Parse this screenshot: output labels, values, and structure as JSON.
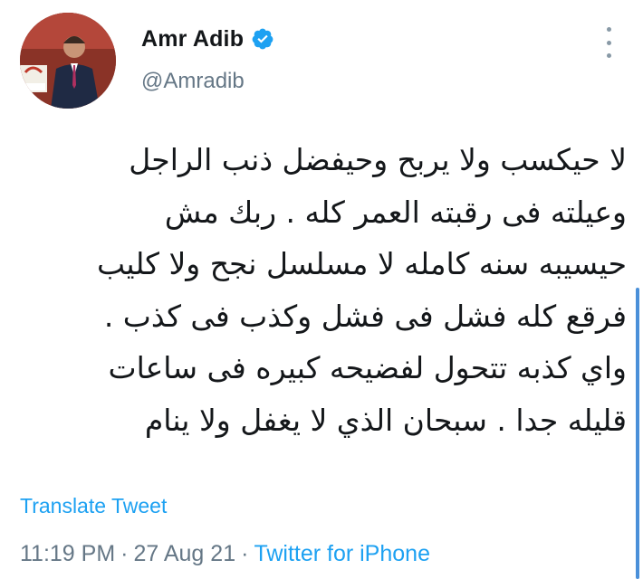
{
  "author": {
    "display_name": "Amr Adib",
    "handle": "@Amradib",
    "verified": true
  },
  "tweet": {
    "lines": [
      "لا حيكسب ولا يربح وحيفضل ذنب الراجل",
      "وعيلته فى رقبته العمر كله . ربك مش",
      "حيسيبه سنه كامله لا مسلسل نجح ولا كليب",
      "فرقع كله فشل فى فشل وكذب فى كذب .",
      "واي كذبه تتحول لفضيحه كبيره فى ساعات",
      "قليله جدا . سبحان الذي لا يغفل ولا ينام"
    ]
  },
  "actions": {
    "translate_label": "Translate Tweet"
  },
  "meta": {
    "time": "11:19 PM",
    "separator": "·",
    "date": "27 Aug 21",
    "source": "Twitter for iPhone"
  },
  "icons": {
    "verified": "verified-badge-icon",
    "more": "more-vertical-icon"
  },
  "colors": {
    "accent": "#1da1f2",
    "muted": "#657786",
    "text": "#14171a"
  }
}
